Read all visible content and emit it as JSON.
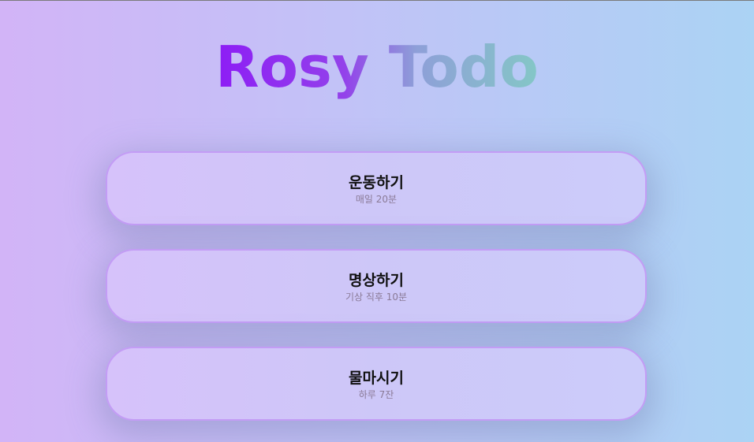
{
  "app": {
    "title": "Rosy Todo"
  },
  "todos": [
    {
      "title": "운동하기",
      "subtitle": "매일 20분"
    },
    {
      "title": "명상하기",
      "subtitle": "기상 직후 10분"
    },
    {
      "title": "물마시기",
      "subtitle": "하루 7잔"
    }
  ],
  "colors": {
    "background_start": "#d2b4f7",
    "background_end": "#abd3f4",
    "title_gradient_start": "#8d1df5",
    "title_gradient_end": "#84c7c6",
    "card_border": "#c39cf5"
  }
}
